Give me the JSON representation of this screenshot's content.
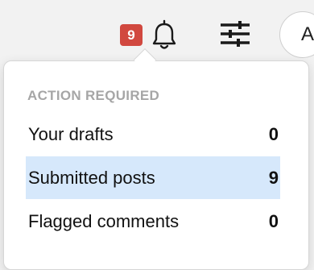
{
  "header": {
    "notification_count": "9",
    "badge_color": "#d1483f",
    "bell_icon": "bell-icon",
    "filter_icon": "sliders-icon",
    "avatar_initial": "A"
  },
  "menu": {
    "section_title": "ACTION REQUIRED",
    "items": [
      {
        "label": "Your drafts",
        "count": "0",
        "selected": false
      },
      {
        "label": "Submitted posts",
        "count": "9",
        "selected": true
      },
      {
        "label": "Flagged comments",
        "count": "0",
        "selected": false
      }
    ],
    "highlight_color": "#d6e8fb"
  }
}
